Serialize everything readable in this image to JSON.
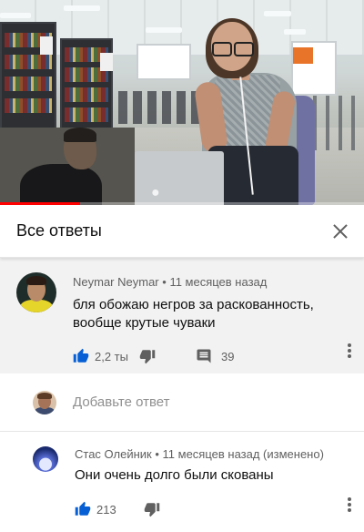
{
  "video": {
    "progress": 0.22,
    "accent": "#ff0000"
  },
  "panel": {
    "title": "Все ответы",
    "close_icon": "close-icon"
  },
  "comment": {
    "author": "Neymar Neymar",
    "separator": "•",
    "time": "11 месяцев назад",
    "text": "бля обожаю негров за раскованность, вообще крутые чуваки",
    "likes": "2,2 ты",
    "replies": "39"
  },
  "add_reply": {
    "placeholder": "Добавьте ответ"
  },
  "replies": [
    {
      "author": "Стас Олейник",
      "separator": "•",
      "time": "11 месяцев назад (изменено)",
      "text": "Они очень долго были скованы",
      "likes": "213"
    }
  ],
  "colors": {
    "like_blue": "#065fd4",
    "icon_gray": "#606060",
    "highlight_bg": "#f2f2f2"
  }
}
